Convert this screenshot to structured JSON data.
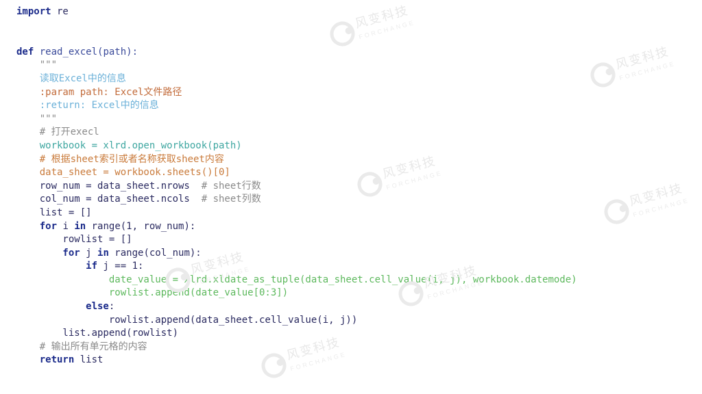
{
  "watermark": {
    "cn": "风变科技",
    "en": "FORCHANGE"
  },
  "code": {
    "l1a": "import",
    "l1b": " re",
    "l2a": "def",
    "l2b": " read_excel(path):",
    "l3": "    \"\"\"",
    "l4": "    读取Excel中的信息",
    "l5": "    :param path: Excel文件路径",
    "l6": "    :return: Excel中的信息",
    "l7": "    \"\"\"",
    "l8": "    # 打开execl",
    "l9": "    workbook = xlrd.open_workbook(path)",
    "l10": "    # 根据sheet索引或者名称获取sheet内容",
    "l11": "    data_sheet = workbook.sheets()[0]",
    "l12a": "    row_num = data_sheet.nrows  ",
    "l12b": "# sheet行数",
    "l13a": "    col_num = data_sheet.ncols  ",
    "l13b": "# sheet列数",
    "l14": "    list = []",
    "l15a": "    for",
    "l15b": " i ",
    "l15c": "in",
    "l15d": " range(1, row_num):",
    "l16": "        rowlist = []",
    "l17a": "        for",
    "l17b": " j ",
    "l17c": "in",
    "l17d": " range(col_num):",
    "l18a": "            if",
    "l18b": " j == 1:",
    "l19": "                date_value = xlrd.xldate_as_tuple(data_sheet.cell_value(i, j), workbook.datemode)",
    "l20": "                rowlist.append(date_value[0:3])",
    "l21a": "            else",
    "l21b": ":",
    "l22": "                rowlist.append(data_sheet.cell_value(i, j))",
    "l23": "        list.append(rowlist)",
    "l24": "    # 输出所有单元格的内容",
    "l25a": "    return",
    "l25b": " list"
  }
}
